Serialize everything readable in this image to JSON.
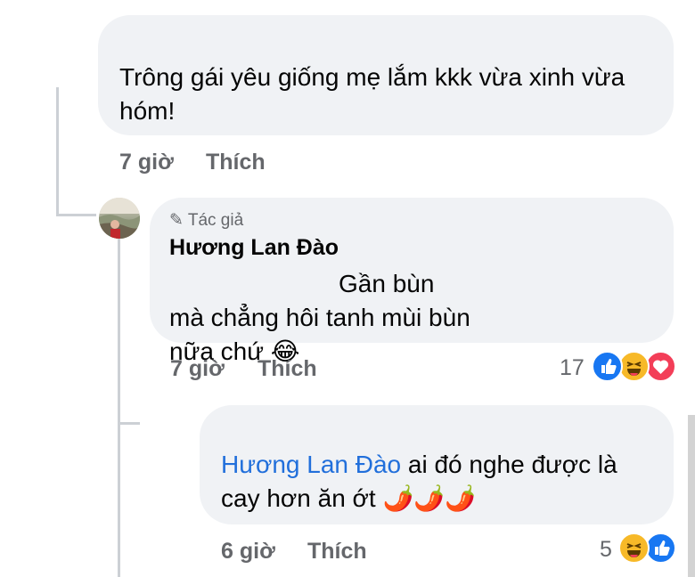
{
  "comments": [
    {
      "text": "Trông gái yêu giống mẹ lắm kkk vừa xinh vừa hóm!",
      "time": "7 giờ",
      "like_label": "Thích"
    },
    {
      "badge": "Tác giả",
      "author": "Hương Lan Đào",
      "text": "Gần bùn mà chẳng hôi tanh mùi bùn nữa chứ",
      "emoji": "😂",
      "time": "7 giờ",
      "like_label": "Thích",
      "reaction_count": "17",
      "reactions": [
        "like",
        "haha",
        "love"
      ]
    },
    {
      "mention": "Hương Lan Đào",
      "text": "ai đó nghe được là cay hơn ăn ớt",
      "emoji": "🌶️🌶️🌶️",
      "time": "6 giờ",
      "like_label": "Thích",
      "reaction_count": "5",
      "reactions": [
        "haha",
        "like"
      ]
    }
  ],
  "colors": {
    "bubble": "#f0f2f5",
    "mention": "#216fdb",
    "meta": "#65676b",
    "like": "#1877f2",
    "haha": "#f7b928",
    "love": "#f33e58"
  }
}
